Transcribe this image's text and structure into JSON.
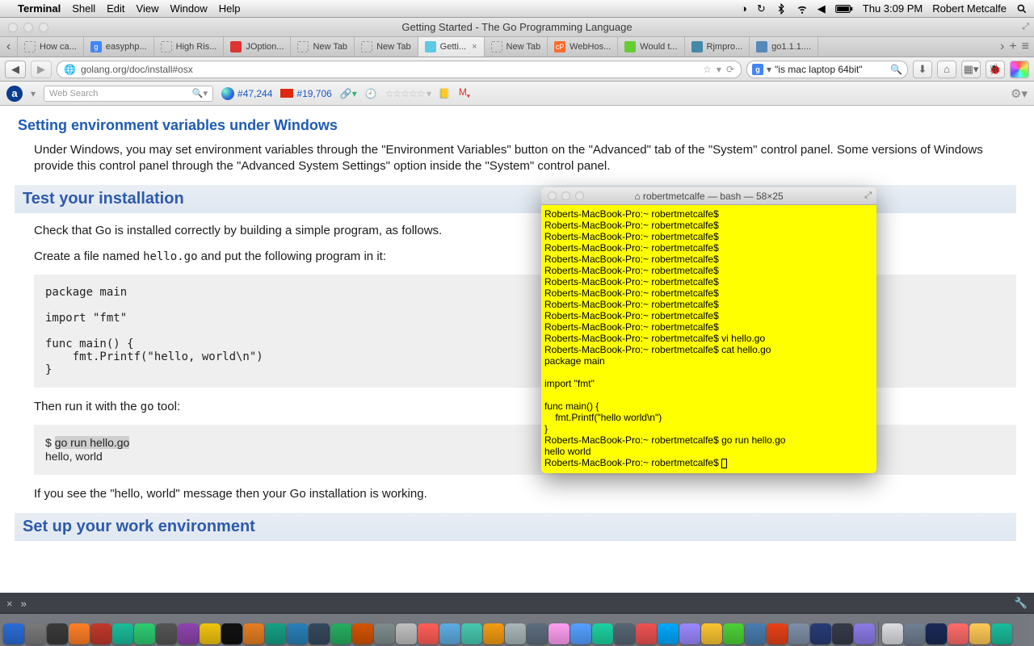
{
  "menubar": {
    "app": "Terminal",
    "items": [
      "Shell",
      "Edit",
      "View",
      "Window",
      "Help"
    ],
    "clock": "Thu 3:09 PM",
    "user": "Robert Metcalfe"
  },
  "browser": {
    "window_title": "Getting Started - The Go Programming Language",
    "tabs": [
      {
        "label": "How ca...",
        "fav": "blank"
      },
      {
        "label": "easyphp...",
        "fav": "google"
      },
      {
        "label": "High Ris...",
        "fav": "blank"
      },
      {
        "label": "JOption...",
        "fav": "joption"
      },
      {
        "label": "New Tab",
        "fav": "blank"
      },
      {
        "label": "New Tab",
        "fav": "blank"
      },
      {
        "label": "Getti...",
        "fav": "go",
        "active": true,
        "closable": true
      },
      {
        "label": "New Tab",
        "fav": "blank"
      },
      {
        "label": "WebHos...",
        "fav": "cp"
      },
      {
        "label": "Would t...",
        "fav": "wt"
      },
      {
        "label": "Rjmpro...",
        "fav": "rj"
      },
      {
        "label": "go1.1.1....",
        "fav": "dl"
      }
    ],
    "url": "golang.org/doc/install#osx",
    "search_query": "\"is mac laptop 64bit\""
  },
  "alexa": {
    "placeholder": "Web Search",
    "rank_global": "#47,244",
    "rank_cn": "#19,706"
  },
  "page": {
    "h_env": "Setting environment variables under Windows",
    "p_env": "Under Windows, you may set environment variables through the \"Environment Variables\" button on the \"Advanced\" tab of the \"System\" control panel. Some versions of Windows provide this control panel through the \"Advanced System Settings\" option inside the \"System\" control panel.",
    "h_test": "Test your installation",
    "p_check": "Check that Go is installed correctly by building a simple program, as follows.",
    "p_create_a": "Create a file named ",
    "p_create_code": "hello.go",
    "p_create_b": " and put the following program in it:",
    "code_hello": "package main\n\nimport \"fmt\"\n\nfunc main() {\n    fmt.Printf(\"hello, world\\n\")\n}",
    "p_run_a": "Then run it with the ",
    "p_run_code": "go",
    "p_run_b": " tool:",
    "code_run_prompt": "$ ",
    "code_run_cmd": "go run hello.go",
    "code_run_out": "hello, world",
    "p_success": "If you see the \"hello, world\" message then your Go installation is working.",
    "h_setup": "Set up your work environment"
  },
  "terminal": {
    "title": "robertmetcalfe — bash — 58×25",
    "body": "Roberts-MacBook-Pro:~ robertmetcalfe$\nRoberts-MacBook-Pro:~ robertmetcalfe$\nRoberts-MacBook-Pro:~ robertmetcalfe$\nRoberts-MacBook-Pro:~ robertmetcalfe$\nRoberts-MacBook-Pro:~ robertmetcalfe$\nRoberts-MacBook-Pro:~ robertmetcalfe$\nRoberts-MacBook-Pro:~ robertmetcalfe$\nRoberts-MacBook-Pro:~ robertmetcalfe$\nRoberts-MacBook-Pro:~ robertmetcalfe$\nRoberts-MacBook-Pro:~ robertmetcalfe$\nRoberts-MacBook-Pro:~ robertmetcalfe$\nRoberts-MacBook-Pro:~ robertmetcalfe$ vi hello.go\nRoberts-MacBook-Pro:~ robertmetcalfe$ cat hello.go\npackage main\n\nimport \"fmt\"\n\nfunc main() {\n    fmt.Printf(\"hello world\\n\")\n}\nRoberts-MacBook-Pro:~ robertmetcalfe$ go run hello.go\nhello world\nRoberts-MacBook-Pro:~ robertmetcalfe$ "
  },
  "dock_colors": [
    "#2a6cd6",
    "#7a7a7a",
    "#3a3a3a",
    "#ff7f27",
    "#c0392b",
    "#1abc9c",
    "#2ecc71",
    "#555555",
    "#8e44ad",
    "#f1c40f",
    "#111111",
    "#e67e22",
    "#16a085",
    "#2980b9",
    "#34495e",
    "#27ae60",
    "#d35400",
    "#7f8c8d",
    "#c0c0c0",
    "#ff5e57",
    "#5dade2",
    "#48c9b0",
    "#f39c12",
    "#aab7b8",
    "#5d6d7e",
    "#ff9ff3",
    "#54a0ff",
    "#1dd1a1",
    "#576574",
    "#ee5253",
    "#00a8ff",
    "#9c88ff",
    "#fbc531",
    "#4cd137",
    "#487eb0",
    "#e84118",
    "#7f8fa6",
    "#273c75",
    "#353b48",
    "#8c7ae6",
    "#dcdde1",
    "#718093",
    "#192a56",
    "#ff6b6b",
    "#feca57",
    "#1abc9c"
  ]
}
